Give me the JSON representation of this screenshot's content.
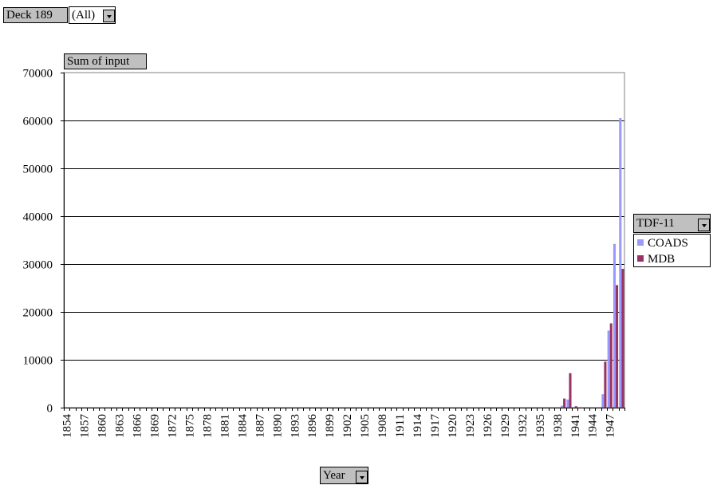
{
  "page_filter": {
    "label": "Deck 189",
    "value": "(All)"
  },
  "data_field": {
    "label": "Sum of input"
  },
  "category_field": {
    "label": "Year"
  },
  "legend": {
    "title": "TDF-11",
    "items": [
      {
        "name": "COADS",
        "color": "#9999ff"
      },
      {
        "name": "MDB",
        "color": "#993366"
      }
    ]
  },
  "chart_data": {
    "type": "bar",
    "title": "",
    "xlabel": "Year",
    "ylabel": "Sum of input",
    "ylim": [
      0,
      70000
    ],
    "yticks": [
      0,
      10000,
      20000,
      30000,
      40000,
      50000,
      60000,
      70000
    ],
    "grid": true,
    "legend_position": "right",
    "categories": [
      1854,
      1855,
      1856,
      1857,
      1858,
      1859,
      1860,
      1861,
      1862,
      1863,
      1864,
      1865,
      1866,
      1867,
      1868,
      1869,
      1870,
      1871,
      1872,
      1873,
      1874,
      1875,
      1876,
      1877,
      1878,
      1879,
      1880,
      1881,
      1882,
      1883,
      1884,
      1885,
      1886,
      1887,
      1888,
      1889,
      1890,
      1891,
      1892,
      1893,
      1894,
      1895,
      1896,
      1897,
      1898,
      1899,
      1900,
      1901,
      1902,
      1903,
      1904,
      1905,
      1906,
      1907,
      1908,
      1909,
      1910,
      1911,
      1912,
      1913,
      1914,
      1915,
      1916,
      1917,
      1918,
      1919,
      1920,
      1921,
      1922,
      1923,
      1924,
      1925,
      1926,
      1927,
      1928,
      1929,
      1930,
      1931,
      1932,
      1933,
      1934,
      1935,
      1936,
      1937,
      1938,
      1939,
      1940,
      1941,
      1942,
      1943,
      1944,
      1945,
      1946,
      1947,
      1948,
      1949
    ],
    "tick_labels": [
      1854,
      1857,
      1860,
      1863,
      1866,
      1869,
      1872,
      1875,
      1878,
      1881,
      1884,
      1887,
      1890,
      1893,
      1896,
      1899,
      1902,
      1905,
      1908,
      1911,
      1914,
      1917,
      1920,
      1923,
      1926,
      1929,
      1932,
      1935,
      1938,
      1941,
      1944,
      1947
    ],
    "series": [
      {
        "name": "COADS",
        "values": [
          0,
          0,
          0,
          0,
          0,
          0,
          0,
          0,
          0,
          0,
          0,
          0,
          0,
          0,
          0,
          0,
          0,
          0,
          0,
          0,
          0,
          0,
          0,
          0,
          0,
          0,
          0,
          0,
          0,
          0,
          0,
          0,
          0,
          0,
          0,
          0,
          0,
          0,
          0,
          0,
          0,
          0,
          0,
          0,
          0,
          0,
          0,
          0,
          0,
          0,
          0,
          0,
          0,
          0,
          0,
          0,
          0,
          0,
          0,
          0,
          0,
          0,
          0,
          0,
          0,
          0,
          0,
          0,
          0,
          0,
          0,
          0,
          0,
          0,
          0,
          0,
          0,
          0,
          0,
          0,
          0,
          0,
          0,
          0,
          0,
          400,
          1700,
          0,
          0,
          0,
          0,
          0,
          2800,
          16100,
          34200,
          60500
        ]
      },
      {
        "name": "MDB",
        "values": [
          0,
          0,
          0,
          0,
          0,
          0,
          0,
          0,
          0,
          0,
          0,
          0,
          0,
          0,
          0,
          0,
          0,
          0,
          0,
          0,
          0,
          0,
          0,
          0,
          0,
          0,
          0,
          0,
          0,
          0,
          0,
          0,
          0,
          0,
          0,
          0,
          0,
          0,
          0,
          0,
          0,
          0,
          0,
          0,
          0,
          0,
          0,
          0,
          0,
          0,
          0,
          0,
          0,
          0,
          0,
          0,
          0,
          0,
          0,
          0,
          0,
          0,
          0,
          0,
          0,
          0,
          0,
          0,
          0,
          0,
          0,
          0,
          0,
          0,
          0,
          0,
          0,
          0,
          0,
          0,
          0,
          0,
          0,
          0,
          0,
          1900,
          7200,
          300,
          0,
          0,
          0,
          0,
          9600,
          17600,
          25600,
          29000
        ]
      }
    ]
  }
}
